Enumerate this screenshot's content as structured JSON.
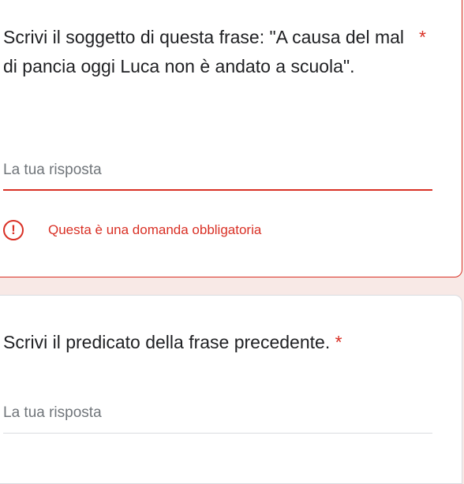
{
  "questions": [
    {
      "title": "Scrivi il soggetto di questa frase: \"A causa del mal di pancia oggi Luca non è andato a scuola\".",
      "required_mark": "*",
      "answer_placeholder": "La tua risposta",
      "error_message": "Questa è una domanda obbligatoria",
      "error_icon_glyph": "!"
    },
    {
      "title": "Scrivi il predicato della frase precedente.",
      "required_mark": "*",
      "answer_placeholder": "La tua risposta"
    }
  ],
  "colors": {
    "page_background": "#f8e9e6",
    "error": "#d93025",
    "text": "#202124",
    "placeholder": "#70757a",
    "divider": "#dadce0"
  },
  "icons": {
    "error": "error-icon"
  }
}
